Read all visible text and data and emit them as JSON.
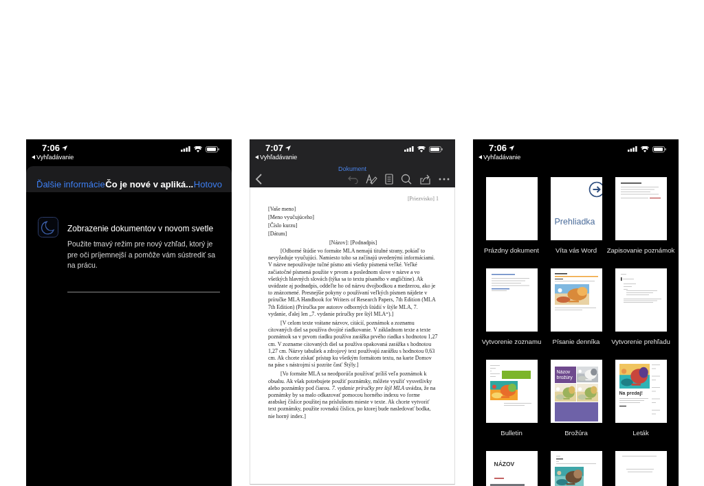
{
  "phones": [
    {
      "kind": "whats-new",
      "status": {
        "time": "7:06",
        "back": "Vyhľadávanie"
      },
      "nav": {
        "left": "Ďalšie informácie",
        "title": "Čo je nové v apliká...",
        "right": "Hotovo"
      },
      "features": [
        {
          "title": "Zobrazenie dokumentov v novom svetle",
          "body": "Použite tmavý režim pre nový vzhľad, ktorý je pre oči príjemnejší a pomôže vám sústrediť sa na prácu."
        }
      ]
    },
    {
      "kind": "document",
      "status": {
        "time": "7:07",
        "back": "Vyhľadávanie"
      },
      "toolbar": {
        "title": "Dokument",
        "undo": {
          "disabled": true
        }
      },
      "document": {
        "header": "[Priezvisko] 1",
        "lines": [
          "[Vaše meno]",
          "[Meno vyučujúceho]",
          "[Číslo kurzu]",
          "[Dátum]"
        ],
        "title": "[Názov]: [Podnadpis]",
        "paragraphs": [
          "[Odborné štúdie vo formáte MLA nemajú titulné strany, pokiaľ to nevyžaduje vyučujúci. Namiesto toho sa začínajú uvedenými informáciami. V názve nepoužívajte tučné písmo ani všetky písmená veľké. Veľké začiatočné písmená použite v prvom a poslednom slove v názve a vo všetkých hlavných slovách (týka sa to textu písaného v angličtine). Ak uvádzate aj podnadpis, oddeľte ho od názvu dvojbodkou a medzerou, ako je to znázornené. Presnejšie pokyny o používaní veľkých písmen nájdete v príručke MLA Handbook for Writers of Research Papers, 7th Edition (MLA 7th Edition) (Príručka pre autorov odborných štúdií v štýle MLA, 7. vydanie, ďalej len „7. vydanie príručky pre štýl MLA“).]",
          "[V celom texte vrátane názvov, citácií, poznámok a zoznamu citovaných diel sa používa dvojité riadkovanie. V základnom texte a texte poznámok sa v prvom riadku používa zarážka prvého riadka s hodnotou 1,27 cm. V zozname citovaných diel sa používa opakovaná zarážka s hodnotou 1,27 cm. Názvy tabuliek a zdrojový text používajú zarážku s hodnotou 0,63 cm. Ak chcete získať prístup ku všetkým formátom textu, na karte Domov na páse s nástrojmi si pozrite časť Štýly.]",
          "[Vo formáte MLA sa neodporúča používať príliš veľa poznámok k obsahu. Ak však potrebujete použiť poznámky, môžete využiť vysvetlivky alebo poznámky pod čiarou. *7. vydanie príručky pre štýl MLA* uvádza, že na poznámky by sa malo odkazovať pomocou horného indexu vo forme arabskej číslice použitej na príslušnom mieste v texte. Ak chcete vytvoriť text poznámky, použite rovnakú číslicu, po ktorej bude nasledovať bodka, nie horný index.]"
        ]
      }
    },
    {
      "kind": "templates",
      "status": {
        "time": "7:06",
        "back": "Vyhľadávanie"
      },
      "templates": [
        {
          "kind": "blank",
          "label": "Prázdny dokument"
        },
        {
          "kind": "tour",
          "text": "Prehliadka",
          "label": "Víta vás Word"
        },
        {
          "kind": "notes",
          "label": "Zapisovanie poznámok"
        },
        {
          "kind": "list",
          "label": "Vytvorenie zoznamu"
        },
        {
          "kind": "journal",
          "label": "Písanie denníka"
        },
        {
          "kind": "outline",
          "label": "Vytvorenie prehľadu"
        },
        {
          "kind": "newsletter",
          "label": "Bulletin"
        },
        {
          "kind": "brochure",
          "text": "Názov brožúry",
          "label": "Brožúra"
        },
        {
          "kind": "flyer",
          "text": "Na predaj!",
          "label": "Leták"
        },
        {
          "kind": "title-photo",
          "text": "NÁZOV"
        },
        {
          "kind": "photo-doc"
        },
        {
          "kind": "letter"
        }
      ]
    }
  ]
}
